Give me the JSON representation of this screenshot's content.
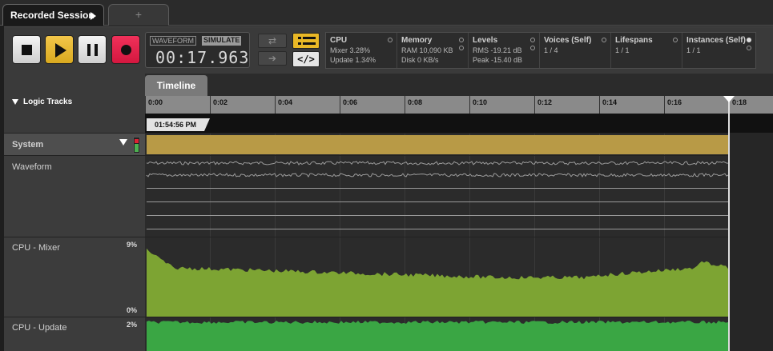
{
  "tabs": {
    "active_label": "Recorded Session",
    "add_label": "+"
  },
  "transport": {
    "mode_waveform": "WAVEFORM",
    "mode_simulate": "SIMULATE",
    "time": "00:17.963",
    "code_button": "</>"
  },
  "metrics": [
    {
      "title": "CPU",
      "line1": "Mixer 3.28%",
      "line2": "Update 1.34%"
    },
    {
      "title": "Memory",
      "line1": "RAM 10,090 KB",
      "line2": "Disk 0 KB/s"
    },
    {
      "title": "Levels",
      "line1": "RMS -19.21 dB",
      "line2": "Peak -15.40 dB"
    },
    {
      "title": "Voices (Self)",
      "line1": "1 / 4",
      "line2": ""
    },
    {
      "title": "Lifespans",
      "line1": "1 / 1",
      "line2": ""
    },
    {
      "title": "Instances (Self)",
      "line1": "1 / 1",
      "line2": ""
    }
  ],
  "left": {
    "logic_tracks_label": "Logic Tracks"
  },
  "tracks": [
    {
      "name": "System",
      "value": ""
    },
    {
      "name": "Waveform",
      "value": ""
    },
    {
      "name": "CPU - Mixer",
      "top_value": "9%",
      "bottom_value": "0%"
    },
    {
      "name": "CPU - Update",
      "top_value": "2%"
    }
  ],
  "timeline": {
    "tab_label": "Timeline",
    "marker_time": "01:54:56 PM",
    "ticks": [
      "0:00",
      "0:02",
      "0:04",
      "0:06",
      "0:08",
      "0:10",
      "0:12",
      "0:14",
      "0:16",
      "0:18"
    ]
  },
  "colors": {
    "system_lane": "#b89a46",
    "cpu_mixer_fill": "#7da433",
    "cpu_update_fill": "#3aa644",
    "play_accent": "#e9b826",
    "record_accent": "#e0204a"
  }
}
